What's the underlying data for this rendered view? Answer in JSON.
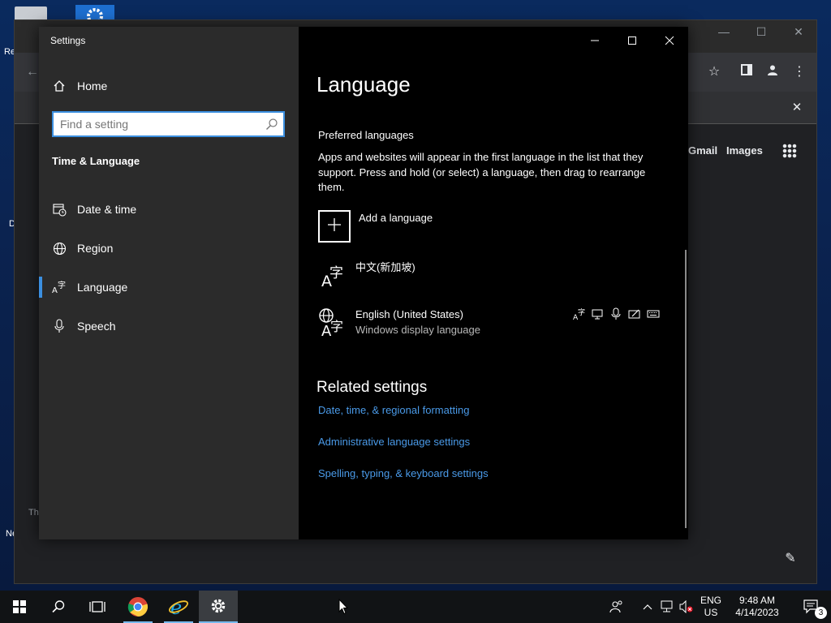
{
  "desktop": {
    "labels": [
      "Re",
      "D",
      "Th",
      "Ne"
    ]
  },
  "chrome": {
    "links": [
      "Gmail",
      "Images"
    ]
  },
  "settings": {
    "title": "Settings",
    "search_placeholder": "Find a setting",
    "home_label": "Home",
    "section_title": "Time & Language",
    "nav": [
      {
        "label": "Date & time",
        "icon": "calendar-clock-icon"
      },
      {
        "label": "Region",
        "icon": "globe-icon"
      },
      {
        "label": "Language",
        "icon": "language-icon",
        "active": true
      },
      {
        "label": "Speech",
        "icon": "microphone-icon"
      }
    ],
    "page_title": "Language",
    "preferred_heading": "Preferred languages",
    "preferred_desc": "Apps and websites will appear in the first language in the list that they support. Press and hold (or select) a language, then drag to rearrange them.",
    "add_language": "Add a language",
    "languages": [
      {
        "name": "中文(新加坡)",
        "sub": ""
      },
      {
        "name": "English (United States)",
        "sub": "Windows display language"
      }
    ],
    "related_heading": "Related settings",
    "related_links": [
      "Date, time, & regional formatting",
      "Administrative language settings",
      "Spelling, typing, & keyboard settings"
    ],
    "accent_color": "#3b8fe0",
    "link_color": "#4a9ae8"
  },
  "taskbar": {
    "lang_top": "ENG",
    "lang_bottom": "US",
    "time": "9:48 AM",
    "date": "4/14/2023",
    "notification_count": "3"
  }
}
